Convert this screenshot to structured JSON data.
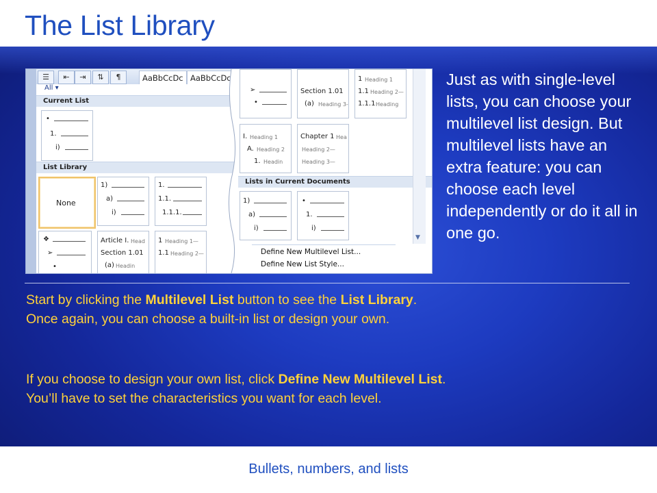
{
  "slide": {
    "title": "The List Library",
    "right_paragraph": "Just as with single-level lists, you can choose your multilevel list design. But multilevel lists have an extra feature: you can choose each level independently or do it all in one go.",
    "p1": {
      "a": "Start by clicking the ",
      "b": "Multilevel List",
      "c": " button to see the ",
      "d": "List Library",
      "e": ". Once again, you can choose a built-in list or design your own."
    },
    "p2": {
      "a": "If you choose to design your own list, click ",
      "b": "Define New Multilevel List",
      "c": ". You’ll have to set the characteristics you want for each level."
    },
    "footer": "Bullets, numbers, and lists"
  },
  "screenshot": {
    "ribbon": {
      "styles": [
        "AaBbCcDc",
        "AaBbCcDc"
      ],
      "pilcrow": "¶"
    },
    "filter": "All",
    "current_list_header": "Current List",
    "list_library_header": "List Library",
    "none_label": "None",
    "current_docs_header": "Lists in Current Documents",
    "menu": [
      "Define New Multilevel List...",
      "Define New List Style..."
    ],
    "tiles": {
      "current": [
        "•",
        "1.",
        "i)"
      ],
      "lib_a": [
        "1)",
        "a)",
        "i)"
      ],
      "lib_b": [
        "1.",
        "1.1.",
        "1.1.1."
      ],
      "lib_c": [
        "❖",
        "➢",
        "•"
      ],
      "lib_d": [
        "Article I.",
        "Head",
        "Section 1.01",
        "(a)",
        "Headin"
      ],
      "lib_e": [
        "1",
        "Heading 1—",
        "1.1",
        "Heading 2—"
      ],
      "r_top1": [
        "➢",
        "•"
      ],
      "r_top2": [
        "Section 1.01",
        "(a)",
        "Heading 3-"
      ],
      "r_top3": [
        "1",
        "Heading 1",
        "1.1",
        "Heading 2—",
        "1.1.1",
        "Heading"
      ],
      "r_mid1": [
        "I.",
        "Heading 1",
        "A.",
        "Heading 2",
        "1.",
        "Headin"
      ],
      "r_mid2": [
        "Chapter 1",
        "Hea",
        "Heading 2—",
        "Heading 3—"
      ],
      "r_doc1": [
        "1)",
        "a)",
        "i)"
      ],
      "r_doc2": [
        "•",
        "1.",
        "i)"
      ]
    }
  }
}
